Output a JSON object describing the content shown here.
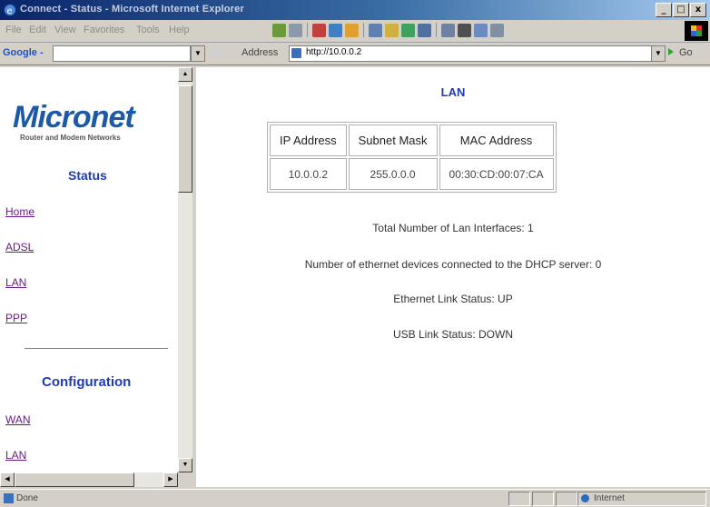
{
  "window": {
    "title": "Connect - Status - Microsoft Internet Explorer",
    "controls": [
      "_",
      "□",
      "x"
    ]
  },
  "menu": {
    "items": [
      "File",
      "Edit",
      "View",
      "Favorites",
      "Tools",
      "Help"
    ]
  },
  "toolbar": {
    "google_label": "Google -",
    "address_label": "Address",
    "url": "http://10.0.0.2",
    "go_label": "Go",
    "accent": "#2050c0"
  },
  "sidebar": {
    "brand": "Micronet",
    "tagline": "Router and Modem Networks",
    "status_heading": "Status",
    "status_links": [
      "Home",
      "ADSL",
      "LAN",
      "PPP"
    ],
    "config_heading": "Configuration",
    "config_links": [
      "WAN",
      "LAN"
    ],
    "link_color": "#6b1a8a",
    "heading_color": "#1e3cb4"
  },
  "main": {
    "title": "LAN",
    "table": {
      "headers": [
        "IP Address",
        "Subnet Mask",
        "MAC Address"
      ],
      "rows": [
        [
          "10.0.0.2",
          "255.0.0.0",
          "00:30:CD:00:07:CA"
        ]
      ]
    },
    "lines": [
      "Total Number of Lan Interfaces: 1",
      "Number of ethernet devices connected to the DHCP server: 0",
      "Ethernet Link Status: UP",
      "USB Link Status: DOWN"
    ]
  },
  "statusbar": {
    "status_text": "Done",
    "zone_text": "Internet"
  }
}
